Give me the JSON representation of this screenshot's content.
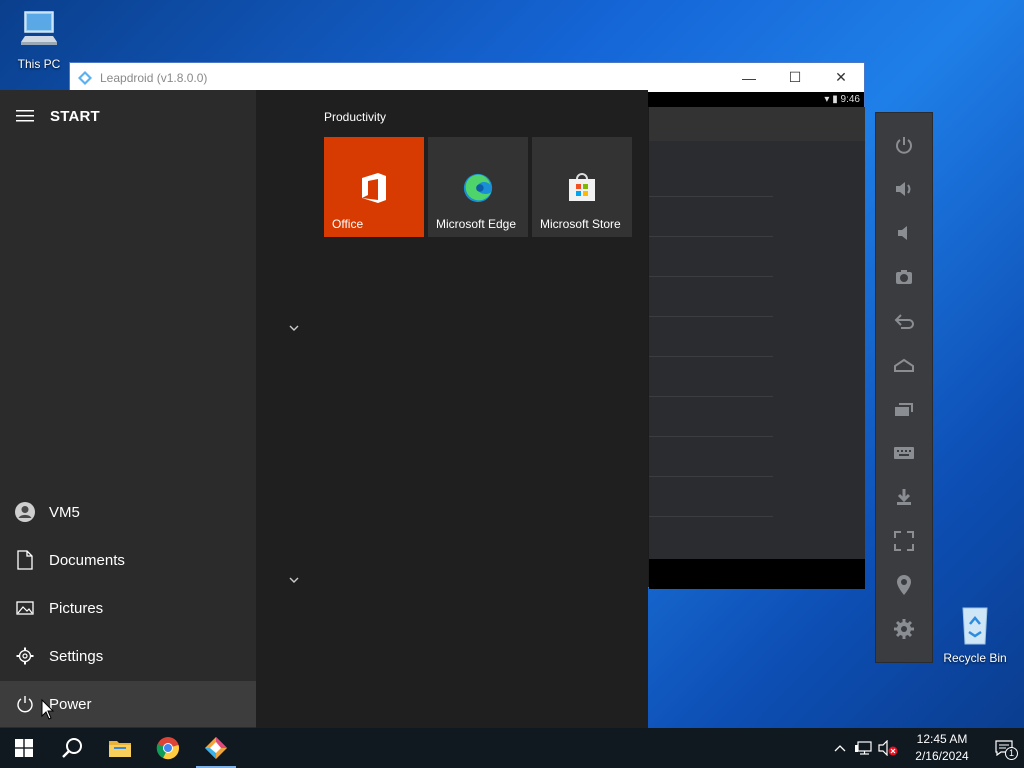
{
  "desktop": {
    "icons": [
      {
        "label": "This PC",
        "icon": "this-pc-icon"
      },
      {
        "label": "Recycle Bin",
        "icon": "recycle-bin-icon"
      }
    ]
  },
  "leapdroid": {
    "title": "Leapdroid (v1.8.0.0)",
    "status_time": "9:46",
    "controls": {
      "minimize": "—",
      "maximize": "☐",
      "close": "✕"
    },
    "toolbar": [
      "power-icon",
      "volume-up-icon",
      "volume-down-icon",
      "camera-icon",
      "back-icon",
      "home-icon",
      "recent-apps-icon",
      "keyboard-icon",
      "download-icon",
      "fullscreen-icon",
      "location-icon",
      "settings-gear-icon"
    ]
  },
  "start_menu": {
    "title": "START",
    "left_items": [
      {
        "label": "VM5",
        "icon": "user-avatar-icon"
      },
      {
        "label": "Documents",
        "icon": "document-icon"
      },
      {
        "label": "Pictures",
        "icon": "pictures-icon"
      },
      {
        "label": "Settings",
        "icon": "gear-icon"
      },
      {
        "label": "Power",
        "icon": "power-icon"
      }
    ],
    "group_label": "Productivity",
    "tiles": [
      {
        "label": "Office",
        "color": "#d83b01"
      },
      {
        "label": "Microsoft Edge",
        "color": "#333333"
      },
      {
        "label": "Microsoft Store",
        "color": "#333333"
      }
    ]
  },
  "taskbar": {
    "apps": [
      "windows-start-icon",
      "search-icon",
      "file-explorer-icon",
      "chrome-icon",
      "leapdroid-icon"
    ],
    "clock_time": "12:45 AM",
    "clock_date": "2/16/2024",
    "notification_count": "1"
  }
}
